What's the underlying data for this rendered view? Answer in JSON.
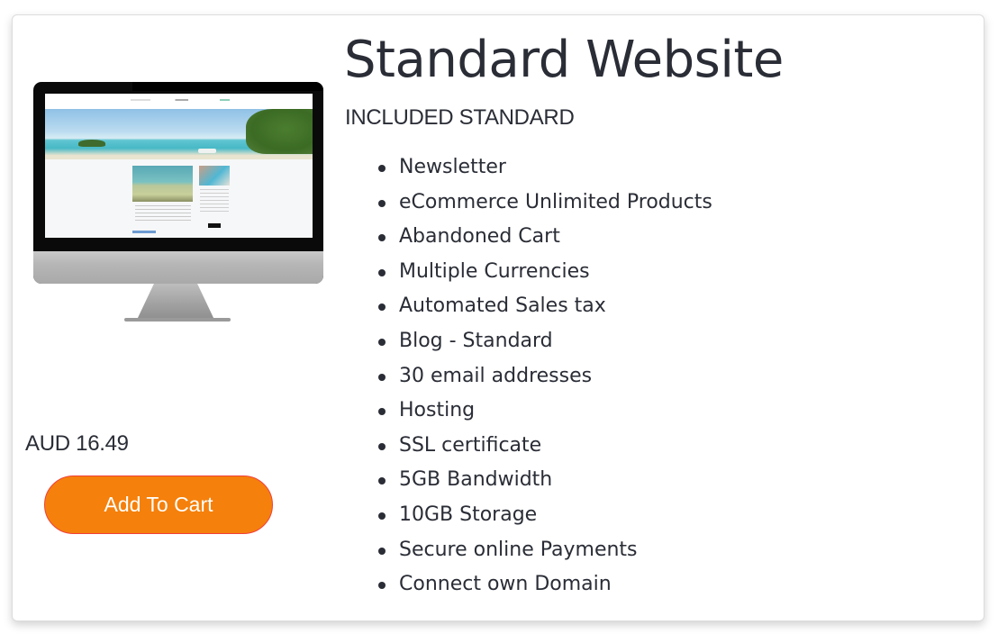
{
  "product": {
    "title": "Standard Website",
    "subtitle": "INCLUDED STANDARD",
    "image_alt": "iMac-style monitor displaying a travel website with beach hero image",
    "price": "AUD 16.49",
    "add_to_cart_label": "Add To Cart",
    "features": [
      "Newsletter",
      "eCommerce Unlimited Products",
      "Abandoned Cart",
      "Multiple Currencies",
      "Automated Sales tax",
      "Blog - Standard",
      "30 email addresses",
      "Hosting",
      "SSL certificate",
      "5GB Bandwidth",
      "10GB Storage",
      "Secure online Payments",
      "Connect own Domain"
    ]
  },
  "colors": {
    "accent_button": "#f5800b",
    "button_border": "#f0403c",
    "text": "#2a2d36"
  }
}
